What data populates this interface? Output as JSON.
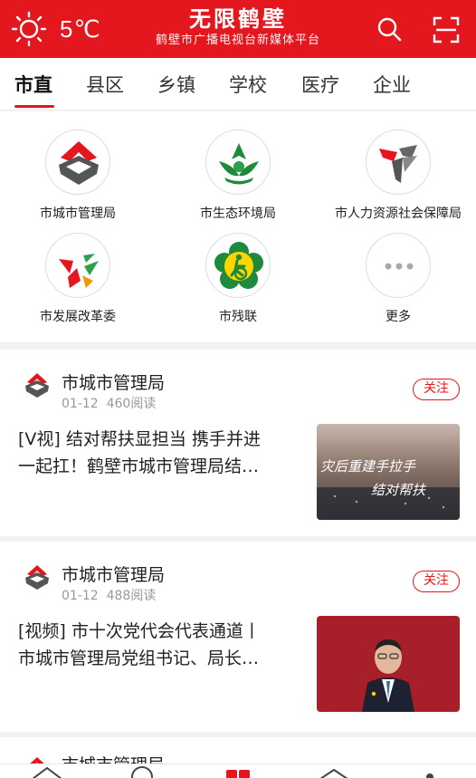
{
  "header": {
    "temperature": "5℃",
    "title": "无限鹤壁",
    "subtitle": "鹤壁市广播电视台新媒体平台",
    "weather_icon": "sun-icon",
    "search_icon": "search-icon",
    "scan_icon": "scan-icon",
    "brand_color": "#e4161e"
  },
  "tabs": [
    {
      "label": "市直",
      "active": true
    },
    {
      "label": "县区"
    },
    {
      "label": "乡镇"
    },
    {
      "label": "学校"
    },
    {
      "label": "医疗"
    },
    {
      "label": "企业"
    }
  ],
  "orgs": [
    {
      "name": "市城市管理局"
    },
    {
      "name": "市生态环境局"
    },
    {
      "name": "市人力资源社会保障局"
    },
    {
      "name": "市发展改革委"
    },
    {
      "name": "市残联"
    },
    {
      "name": "更多"
    }
  ],
  "feed": [
    {
      "source": "市城市管理局",
      "date": "01-12",
      "reads": "460阅读",
      "follow": "关注",
      "headline_line1": "[V视] 结对帮扶显担当 携手并进",
      "headline_line2": "一起扛！鹤壁市城市管理局结…",
      "thumb_text1": "灾后重建手拉手",
      "thumb_text2": "结对帮扶"
    },
    {
      "source": "市城市管理局",
      "date": "01-12",
      "reads": "488阅读",
      "follow": "关注",
      "headline_line1": "[视频] 市十次党代会代表通道丨",
      "headline_line2": "市城市管理局党组书记、局长…"
    },
    {
      "source": "市城市管理局"
    }
  ]
}
